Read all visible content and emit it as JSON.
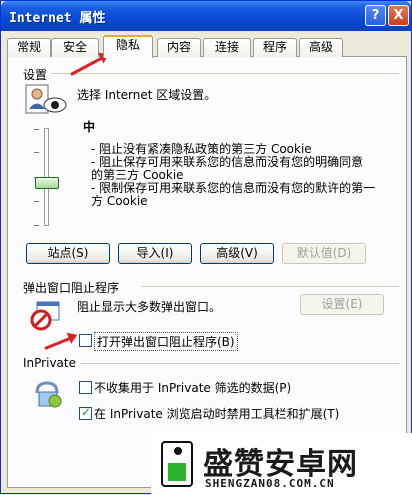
{
  "window": {
    "title": "Internet 属性",
    "help_label": "?",
    "close_label": "X"
  },
  "tabs": [
    {
      "label": "常规"
    },
    {
      "label": "安全"
    },
    {
      "label": "隐私",
      "active": true
    },
    {
      "label": "内容"
    },
    {
      "label": "连接"
    },
    {
      "label": "程序"
    },
    {
      "label": "高级"
    }
  ],
  "settings": {
    "group_label": "设置",
    "instruction": "选择 Internet 区域设置。",
    "level": "中",
    "bullets": [
      "- 阻止没有紧凑隐私政策的第三方 Cookie",
      "- 阻止保存可用来联系您的信息而没有您的明确同意",
      "的第三方 Cookie",
      "- 限制保存可用来联系您的信息而没有您的默许的第一",
      "方 Cookie"
    ],
    "slider_level_fraction": 0.5,
    "buttons": {
      "sites": "站点(S)",
      "import": "导入(I)",
      "advanced": "高级(V)",
      "default": "默认值(D)"
    }
  },
  "popup": {
    "group_label": "弹出窗口阻止程序",
    "description": "阻止显示大多数弹出窗口。",
    "settings_button": "设置(E)",
    "enable_label": "打开弹出窗口阻止程序(B)",
    "enabled": false
  },
  "inprivate": {
    "group_label": "InPrivate",
    "no_collect_label": "不收集用于 InPrivate 筛选的数据(P)",
    "no_collect_checked": false,
    "disable_toolbars_label": "在 InPrivate 浏览启动时禁用工具栏和扩展(T)",
    "disable_toolbars_checked": true
  },
  "watermark": {
    "title": "盛赞安卓网",
    "url": "SHENGZAN08.COM.CN"
  },
  "colors": {
    "titlebar": "#0b4fd9",
    "arrow": "#e02020",
    "active_tab_accent": "#e8a93a"
  }
}
